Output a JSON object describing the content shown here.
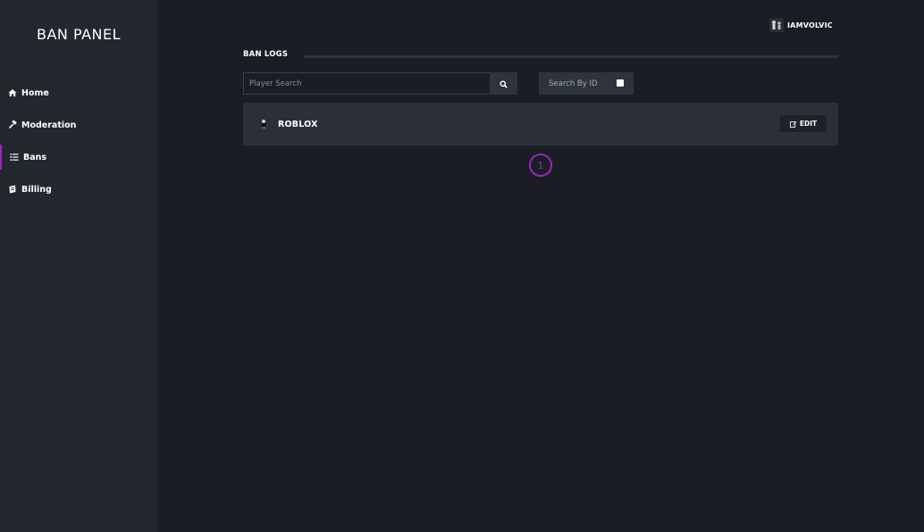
{
  "app": {
    "title": "BAN PANEL"
  },
  "sidebar": {
    "items": [
      {
        "label": "Home",
        "icon": "home-icon"
      },
      {
        "label": "Moderation",
        "icon": "hammer-icon"
      },
      {
        "label": "Bans",
        "icon": "list-icon",
        "active": true
      },
      {
        "label": "Billing",
        "icon": "receipt-icon"
      }
    ],
    "accent": "#a020c8"
  },
  "user": {
    "name": "IAMVOLVIC"
  },
  "main": {
    "section_title": "BAN LOGS",
    "search": {
      "placeholder": "Player Search",
      "value": ""
    },
    "search_by_id": {
      "label": "Search By ID",
      "checked": false
    },
    "bans": [
      {
        "name": "ROBLOX",
        "edit_label": "EDIT"
      }
    ],
    "pagination": {
      "current_page": "1"
    }
  },
  "colors": {
    "background": "#1a1e24",
    "sidebar": "#23282f",
    "panel": "#2b3038",
    "accent": "#9a23b8"
  }
}
